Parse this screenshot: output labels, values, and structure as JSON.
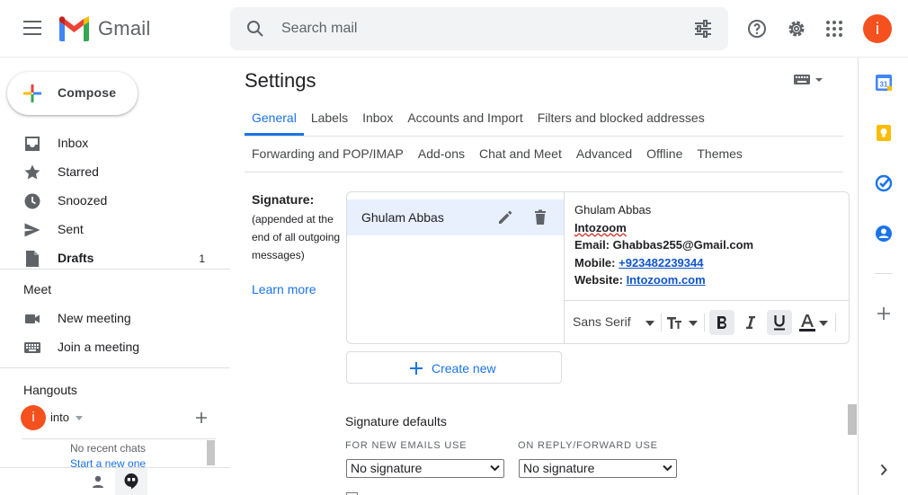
{
  "header": {
    "app_name": "Gmail",
    "search_placeholder": "Search mail",
    "avatar_letter": "i"
  },
  "leftnav": {
    "compose_label": "Compose",
    "items": [
      {
        "label": "Inbox",
        "count": ""
      },
      {
        "label": "Starred",
        "count": ""
      },
      {
        "label": "Snoozed",
        "count": ""
      },
      {
        "label": "Sent",
        "count": ""
      },
      {
        "label": "Drafts",
        "count": "1"
      }
    ],
    "meet": {
      "title": "Meet",
      "new_meeting": "New meeting",
      "join_meeting": "Join a meeting"
    },
    "hangouts": {
      "title": "Hangouts",
      "avatar_letter": "i",
      "user_name": "into",
      "no_chats": "No recent chats",
      "start_new": "Start a new one"
    }
  },
  "main": {
    "title": "Settings",
    "tabs_row1": [
      "General",
      "Labels",
      "Inbox",
      "Accounts and Import",
      "Filters and blocked addresses"
    ],
    "tabs_row2": [
      "Forwarding and POP/IMAP",
      "Add-ons",
      "Chat and Meet",
      "Advanced",
      "Offline",
      "Themes"
    ],
    "active_tab": "General",
    "signature": {
      "label": "Signature:",
      "sublabel": "(appended at the end of all outgoing messages)",
      "learn_more": "Learn more",
      "list": [
        {
          "name": "Ghulam Abbas"
        }
      ],
      "content": {
        "line1": "Ghulam Abbas",
        "line2": "Intozoom",
        "email_label": "Email:",
        "email_value": "Ghabbas255@Gmail.com",
        "mobile_label": "Mobile:",
        "mobile_value": "+923482239344",
        "website_label": "Website:",
        "website_value": "Intozoom.com"
      },
      "toolbar": {
        "font": "Sans Serif"
      },
      "create_new": "Create new"
    },
    "defaults": {
      "title": "Signature defaults",
      "new_emails_label": "FOR NEW EMAILS USE",
      "reply_label": "ON REPLY/FORWARD USE",
      "new_emails_value": "No signature",
      "reply_value": "No signature"
    }
  },
  "colors": {
    "accent": "#1a73e8",
    "avatar": "#f4511e",
    "active_row": "#e8f0fe"
  }
}
